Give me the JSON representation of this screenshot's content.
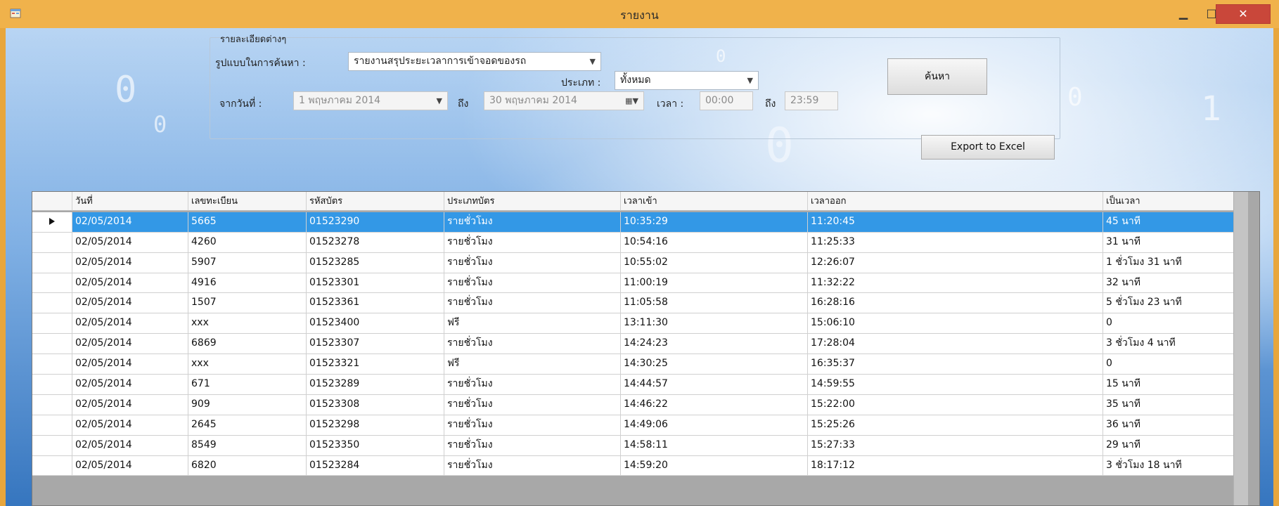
{
  "window": {
    "title": "รายงาน",
    "icons": {
      "app": "app-window-icon",
      "minimize": "minimize-icon",
      "maximize": "maximize-icon",
      "close": "close-icon"
    }
  },
  "search_panel": {
    "group_title": "รายละเอียดต่างๆ",
    "search_format_label": "รูปแบบในการค้นหา :",
    "search_format_value": "รายงานสรุประยะเวลาการเข้าจอดของรถ",
    "type_label": "ประเภท :",
    "type_value": "ทั้งหมด",
    "from_date_label": "จากวันที่ :",
    "from_date_value": "1 พฤษภาคม 2014",
    "to_label": "ถึง",
    "to_date_value": "30 พฤษภาคม 2014",
    "time_label": "เวลา :",
    "time_from": "00:00",
    "time_to_label": "ถึง",
    "time_to": "23:59",
    "search_button": "ค้นหา",
    "export_button": "Export to Excel"
  },
  "table": {
    "columns": [
      "วันที่",
      "เลขทะเบียน",
      "รหัสบัตร",
      "ประเภทบัตร",
      "เวลาเข้า",
      "เวลาออก",
      "เป็นเวลา"
    ],
    "rows": [
      [
        "02/05/2014",
        "5665",
        "01523290",
        "รายชั่วโมง",
        "10:35:29",
        "11:20:45",
        "45 นาที"
      ],
      [
        "02/05/2014",
        "4260",
        "01523278",
        "รายชั่วโมง",
        "10:54:16",
        "11:25:33",
        "31 นาที"
      ],
      [
        "02/05/2014",
        "5907",
        "01523285",
        "รายชั่วโมง",
        "10:55:02",
        "12:26:07",
        "1 ชั่วโมง 31 นาที"
      ],
      [
        "02/05/2014",
        "4916",
        "01523301",
        "รายชั่วโมง",
        "11:00:19",
        "11:32:22",
        "32 นาที"
      ],
      [
        "02/05/2014",
        "1507",
        "01523361",
        "รายชั่วโมง",
        "11:05:58",
        "16:28:16",
        "5 ชั่วโมง 23 นาที"
      ],
      [
        "02/05/2014",
        "xxx",
        "01523400",
        "ฟรี",
        "13:11:30",
        "15:06:10",
        "0"
      ],
      [
        "02/05/2014",
        "6869",
        "01523307",
        "รายชั่วโมง",
        "14:24:23",
        "17:28:04",
        "3 ชั่วโมง 4 นาที"
      ],
      [
        "02/05/2014",
        "xxx",
        "01523321",
        "ฟรี",
        "14:30:25",
        "16:35:37",
        "0"
      ],
      [
        "02/05/2014",
        "671",
        "01523289",
        "รายชั่วโมง",
        "14:44:57",
        "14:59:55",
        "15 นาที"
      ],
      [
        "02/05/2014",
        "909",
        "01523308",
        "รายชั่วโมง",
        "14:46:22",
        "15:22:00",
        "35 นาที"
      ],
      [
        "02/05/2014",
        "2645",
        "01523298",
        "รายชั่วโมง",
        "14:49:06",
        "15:25:26",
        "36 นาที"
      ],
      [
        "02/05/2014",
        "8549",
        "01523350",
        "รายชั่วโมง",
        "14:58:11",
        "15:27:33",
        "29 นาที"
      ],
      [
        "02/05/2014",
        "6820",
        "01523284",
        "รายชั่วโมง",
        "14:59:20",
        "18:17:12",
        "3 ชั่วโมง 18 นาที"
      ]
    ]
  },
  "colors": {
    "title_bar": "#f0b24b",
    "selection": "#3398e6",
    "close_button": "#c9473a"
  }
}
